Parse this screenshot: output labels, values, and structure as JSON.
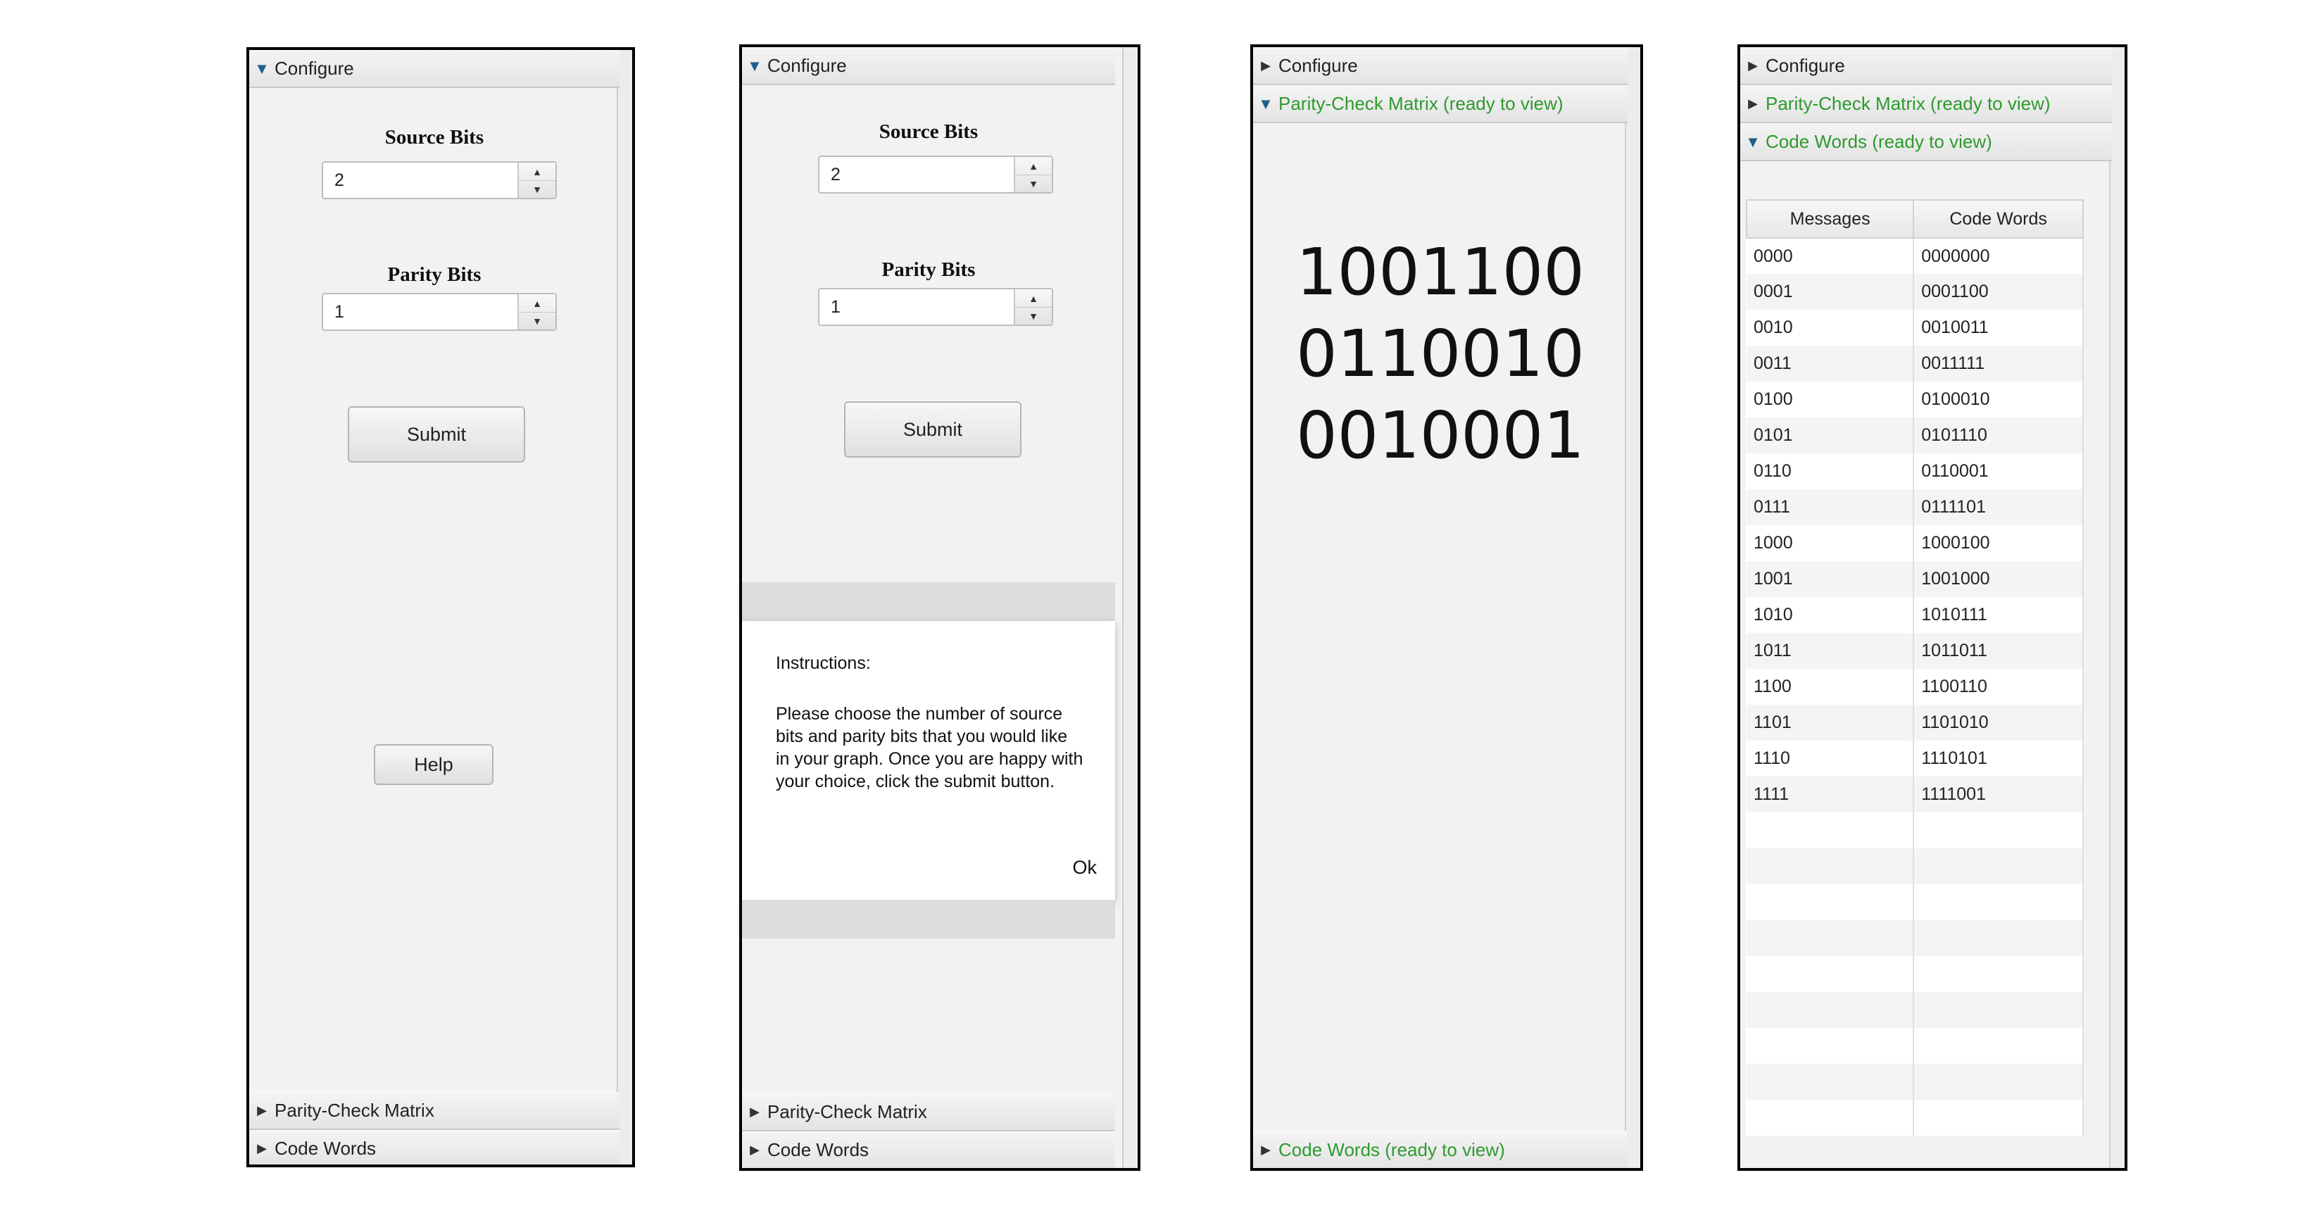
{
  "panel1": {
    "headers": {
      "configure": "Configure",
      "parity": "Parity-Check Matrix",
      "codewords": "Code Words"
    },
    "source_label": "Source Bits",
    "source_value": "2",
    "parity_label": "Parity Bits",
    "parity_value": "1",
    "submit": "Submit",
    "help": "Help"
  },
  "panel2": {
    "headers": {
      "configure": "Configure",
      "parity": "Parity-Check Matrix",
      "codewords": "Code Words"
    },
    "source_label": "Source Bits",
    "source_value": "2",
    "parity_label": "Parity Bits",
    "parity_value": "1",
    "submit": "Submit",
    "dialog_title": "Instructions:",
    "dialog_line1": "Please choose the number of source",
    "dialog_line2": "bits and parity bits that you would like",
    "dialog_line3": "in your graph. Once you are happy with",
    "dialog_line4": "your choice, click the submit button.",
    "dialog_ok": "Ok"
  },
  "panel3": {
    "headers": {
      "configure": "Configure",
      "parity": "Parity-Check Matrix (ready to view)",
      "codewords": "Code Words (ready to view)"
    },
    "matrix_rows": [
      "1001100",
      "0110010",
      "0010001"
    ]
  },
  "panel4": {
    "headers": {
      "configure": "Configure",
      "parity": "Parity-Check Matrix (ready to view)",
      "codewords": "Code Words (ready to view)"
    },
    "table_headers": [
      "Messages",
      "Code Words"
    ],
    "rows": [
      [
        "0000",
        "0000000"
      ],
      [
        "0001",
        "0001100"
      ],
      [
        "0010",
        "0010011"
      ],
      [
        "0011",
        "0011111"
      ],
      [
        "0100",
        "0100010"
      ],
      [
        "0101",
        "0101110"
      ],
      [
        "0110",
        "0110001"
      ],
      [
        "0111",
        "0111101"
      ],
      [
        "1000",
        "1000100"
      ],
      [
        "1001",
        "1001000"
      ],
      [
        "1010",
        "1010111"
      ],
      [
        "1011",
        "1011011"
      ],
      [
        "1100",
        "1100110"
      ],
      [
        "1101",
        "1101010"
      ],
      [
        "1110",
        "1110101"
      ],
      [
        "1111",
        "1111001"
      ]
    ]
  },
  "colors": {
    "ready_green": "#2e9a2e",
    "expanded_arrow": "#1f5f8a"
  }
}
